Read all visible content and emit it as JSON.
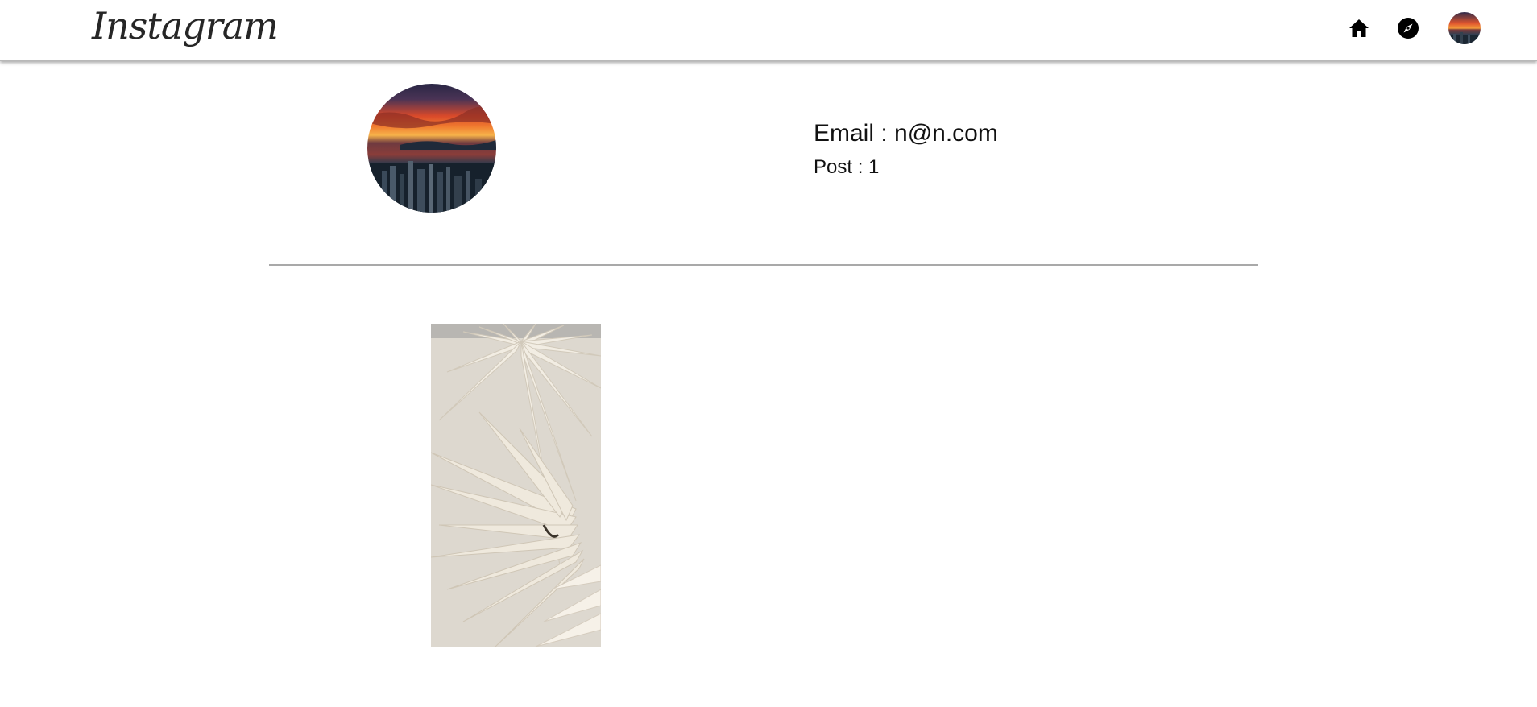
{
  "app": {
    "logo_text": "Instagram"
  },
  "nav": {
    "home_icon": "home-icon",
    "explore_icon": "compass-icon",
    "avatar": "avatar"
  },
  "profile": {
    "email_text": "Email : n@n.com",
    "posts_text": "Post : 1"
  },
  "posts": [
    {
      "image": "palm-leaf-photo"
    }
  ],
  "colors": {
    "background": "#ffffff",
    "text": "#111111",
    "logo": "#262626",
    "divider": "#a9a9a9"
  }
}
